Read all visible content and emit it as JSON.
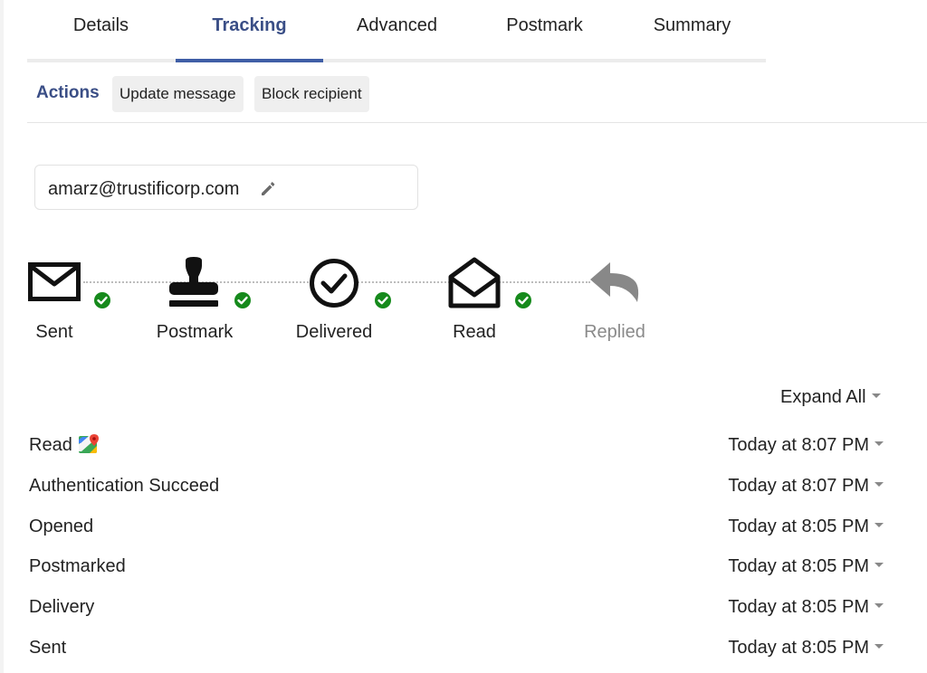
{
  "tabs": [
    {
      "label": "Details",
      "active": false
    },
    {
      "label": "Tracking",
      "active": true
    },
    {
      "label": "Advanced",
      "active": false
    },
    {
      "label": "Postmark",
      "active": false
    },
    {
      "label": "Summary",
      "active": false
    }
  ],
  "actions": {
    "label": "Actions",
    "update_label": "Update message",
    "block_label": "Block recipient"
  },
  "recipient": {
    "email": "amarz@trustificorp.com",
    "edit_icon": "pencil-icon"
  },
  "steps": [
    {
      "label": "Sent",
      "icon": "envelope-icon",
      "completed": true
    },
    {
      "label": "Postmark",
      "icon": "stamp-icon",
      "completed": true
    },
    {
      "label": "Delivered",
      "icon": "check-circle-icon",
      "completed": true
    },
    {
      "label": "Read",
      "icon": "open-envelope-icon",
      "completed": true
    },
    {
      "label": "Replied",
      "icon": "reply-icon",
      "completed": false
    }
  ],
  "expand_label": "Expand All",
  "events": [
    {
      "name": "Read",
      "time": "Today at 8:07 PM",
      "icon": "map-icon"
    },
    {
      "name": "Authentication Succeed",
      "time": "Today at 8:07 PM"
    },
    {
      "name": "Opened",
      "time": "Today at 8:05 PM"
    },
    {
      "name": "Postmarked",
      "time": "Today at 8:05 PM"
    },
    {
      "name": "Delivery",
      "time": "Today at 8:05 PM"
    },
    {
      "name": "Sent",
      "time": "Today at 8:05 PM"
    }
  ],
  "colors": {
    "accent": "#3f5ea6",
    "accent_text": "#3a4e86",
    "success": "#168a1c",
    "muted": "#8a8a8a"
  }
}
